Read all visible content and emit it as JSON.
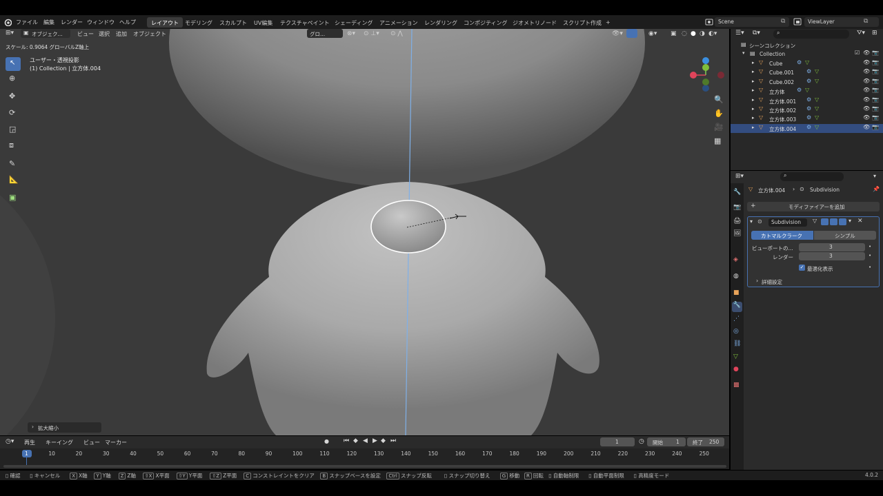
{
  "top_menu": {
    "items": [
      "ファイル",
      "編集",
      "レンダー",
      "ウィンドウ",
      "ヘルプ"
    ],
    "workspaces": [
      "レイアウト",
      "モデリング",
      "スカルプト",
      "UV編集",
      "テクスチャペイント",
      "シェーディング",
      "アニメーション",
      "レンダリング",
      "コンポジティング",
      "ジオメトリノード",
      "スクリプト作成"
    ],
    "active_workspace": "レイアウト",
    "add_tab": "+",
    "scene": "Scene",
    "view_layer": "ViewLayer"
  },
  "viewport_header": {
    "mode": "オブジェク...",
    "menus": [
      "ビュー",
      "選択",
      "追加",
      "オブジェクト"
    ],
    "transform_orientation": "グロ...",
    "operator_info": "スケール: 0.9064 グローバルZ軸上"
  },
  "viewport": {
    "view_name": "ユーザー・透視投影",
    "collection_info": "(1) Collection | 立方体.004",
    "last_op_panel": "拡大縮小",
    "gizmo_axes": [
      "X",
      "Y",
      "Z"
    ]
  },
  "outliner": {
    "search_placeholder": "",
    "root": "シーンコレクション",
    "collection": "Collection",
    "objects": [
      "Cube",
      "Cube.001",
      "Cube.002",
      "立方体",
      "立方体.001",
      "立方体.002",
      "立方体.003",
      "立方体.004"
    ],
    "selected": "立方体.004"
  },
  "properties": {
    "breadcrumb_object": "立方体.004",
    "breadcrumb_modifier": "Subdivision",
    "add_modifier": "モディファイアーを追加",
    "modifier_name": "Subdivision",
    "type_options": [
      "カトマルクラーク",
      "シンプル"
    ],
    "active_type": "カトマルクラーク",
    "viewport_label": "ビューポートの...",
    "viewport_value": "3",
    "render_label": "レンダー",
    "render_value": "3",
    "optimal_display": "最適化表示",
    "optimal_checked": true,
    "advanced": "詳細設定"
  },
  "timeline": {
    "menus": [
      "再生",
      "キーイング",
      "ビュー",
      "マーカー"
    ],
    "current_frame": "1",
    "start_label": "開始",
    "start": "1",
    "end_label": "終了",
    "end": "250",
    "ticks": [
      "1",
      "10",
      "20",
      "30",
      "40",
      "50",
      "60",
      "70",
      "80",
      "90",
      "100",
      "110",
      "120",
      "130",
      "140",
      "150",
      "160",
      "170",
      "180",
      "190",
      "200",
      "210",
      "220",
      "230",
      "240",
      "250"
    ]
  },
  "statusbar": {
    "items": [
      {
        "key": "",
        "label": "確認"
      },
      {
        "key": "",
        "label": "キャンセル"
      },
      {
        "key": "X",
        "label": "X軸"
      },
      {
        "key": "Y",
        "label": "Y軸"
      },
      {
        "key": "Z",
        "label": "Z軸"
      },
      {
        "key": "⇧X",
        "label": "X平面"
      },
      {
        "key": "⇧Y",
        "label": "Y平面"
      },
      {
        "key": "⇧Z",
        "label": "Z平面"
      },
      {
        "key": "C",
        "label": "コンストレイントをクリア"
      },
      {
        "key": "B",
        "label": "スナップベースを設定"
      },
      {
        "key": "Ctrl",
        "label": "スナップ反転"
      },
      {
        "key": "",
        "label": "スナップ切り替え"
      },
      {
        "key": "G",
        "label": "移動"
      },
      {
        "key": "R",
        "label": "回転"
      },
      {
        "key": "",
        "label": "自動軸制限"
      },
      {
        "key": "",
        "label": "自動平面制限"
      },
      {
        "key": "",
        "label": "高精度モード"
      }
    ],
    "version": "4.0.2"
  },
  "colors": {
    "accent": "#4772b3",
    "selected_row": "#334d80",
    "axis_x": "#e0445b",
    "axis_y": "#7fbf3c",
    "axis_z": "#3b8fe0"
  }
}
